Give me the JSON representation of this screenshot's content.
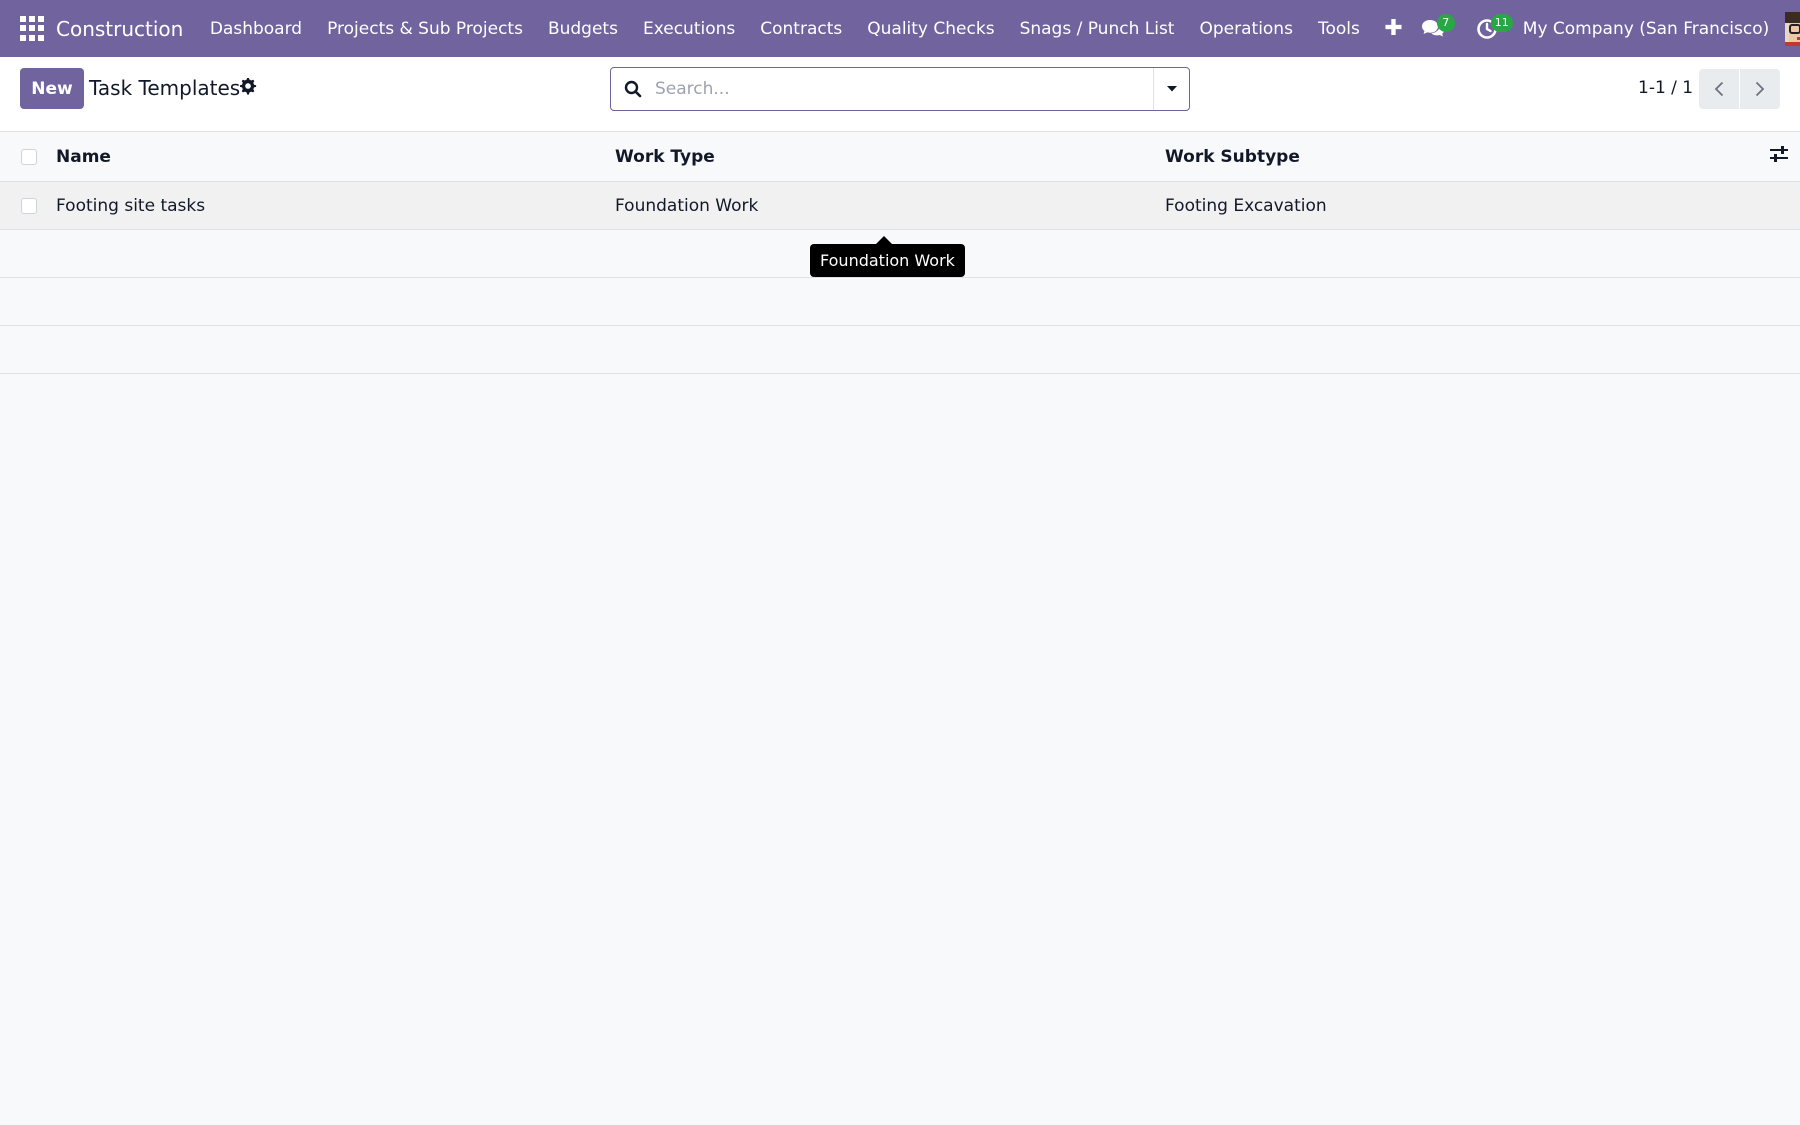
{
  "navbar": {
    "brand": "Construction",
    "menu": [
      {
        "label": "Dashboard"
      },
      {
        "label": "Projects & Sub Projects"
      },
      {
        "label": "Budgets"
      },
      {
        "label": "Executions"
      },
      {
        "label": "Contracts"
      },
      {
        "label": "Quality Checks"
      },
      {
        "label": "Snags / Punch List"
      },
      {
        "label": "Operations"
      },
      {
        "label": "Tools"
      }
    ],
    "messages_count": "7",
    "activities_count": "11",
    "company": "My Company (San Francisco)",
    "accent_color": "#71639e",
    "badge_color": "#28a745"
  },
  "control_panel": {
    "new_label": "New",
    "title": "Task Templates",
    "search_placeholder": "Search...",
    "pager": "1-1 / 1"
  },
  "list": {
    "columns": {
      "name": "Name",
      "work_type": "Work Type",
      "work_subtype": "Work Subtype"
    },
    "rows": [
      {
        "name": "Footing site tasks",
        "work_type": "Foundation Work",
        "work_subtype": "Footing Excavation"
      }
    ]
  },
  "tooltip": {
    "text": "Foundation Work"
  }
}
